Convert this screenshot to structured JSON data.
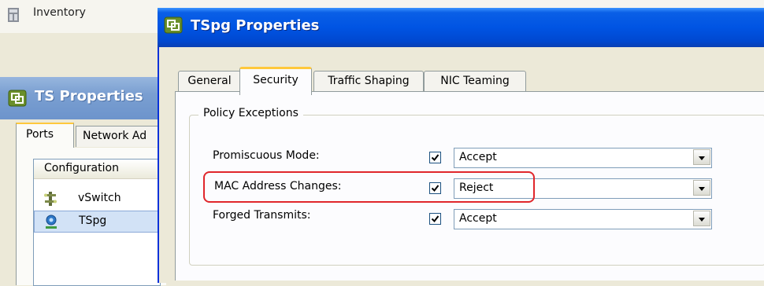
{
  "inventory": {
    "label": "Inventory"
  },
  "ts_window": {
    "title": "TS Properties",
    "tabs": [
      "Ports",
      "Network Ad"
    ],
    "list": {
      "header": "Configuration",
      "rows": [
        {
          "label": "vSwitch",
          "icon": "vswitch-icon",
          "selected": false
        },
        {
          "label": "TSpg",
          "icon": "portgroup-icon",
          "selected": true
        }
      ]
    }
  },
  "dialog": {
    "title": "TSpg Properties",
    "tabs": [
      {
        "label": "General",
        "active": false
      },
      {
        "label": "Security",
        "active": true
      },
      {
        "label": "Traffic Shaping",
        "active": false
      },
      {
        "label": "NIC Teaming",
        "active": false
      }
    ],
    "group_title": "Policy Exceptions",
    "policies": [
      {
        "label": "Promiscuous Mode:",
        "checked": true,
        "value": "Accept"
      },
      {
        "label": "MAC Address Changes:",
        "checked": true,
        "value": "Reject"
      },
      {
        "label": "Forged Transmits:",
        "checked": true,
        "value": "Accept"
      }
    ]
  },
  "colors": {
    "title_bar": "#0054e3",
    "highlight": "#e0262b",
    "tab_active_accent": "#ffc83c"
  }
}
